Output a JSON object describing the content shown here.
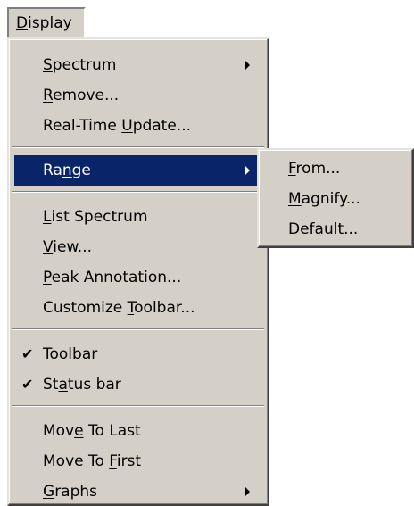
{
  "menubar": {
    "display": {
      "pre": "",
      "u": "D",
      "post": "isplay"
    }
  },
  "menu": {
    "items": [
      {
        "pre": "",
        "u": "S",
        "post": "pectrum"
      },
      {
        "pre": "",
        "u": "R",
        "post": "emove..."
      },
      {
        "pre": "Real-Time ",
        "u": "U",
        "post": "pdate..."
      },
      {
        "pre": "Ra",
        "u": "n",
        "post": "ge"
      },
      {
        "pre": "",
        "u": "L",
        "post": "ist Spectrum"
      },
      {
        "pre": "",
        "u": "V",
        "post": "iew..."
      },
      {
        "pre": "",
        "u": "P",
        "post": "eak Annotation..."
      },
      {
        "pre": "Customize ",
        "u": "T",
        "post": "oolbar..."
      },
      {
        "pre": "T",
        "u": "o",
        "post": "olbar"
      },
      {
        "pre": "St",
        "u": "a",
        "post": "tus bar"
      },
      {
        "pre": "Mov",
        "u": "e",
        "post": " To Last"
      },
      {
        "pre": "Move To ",
        "u": "F",
        "post": "irst"
      },
      {
        "pre": "",
        "u": "G",
        "post": "raphs"
      }
    ]
  },
  "submenu": {
    "items": [
      {
        "pre": "",
        "u": "F",
        "post": "rom..."
      },
      {
        "pre": "",
        "u": "M",
        "post": "agnify..."
      },
      {
        "pre": "",
        "u": "D",
        "post": "efault..."
      }
    ]
  },
  "icons": {
    "check": "✔",
    "submenu_arrow": "chevron-right-icon"
  },
  "colors": {
    "menu_bg": "#d4d0c8",
    "highlight": "#0a246a",
    "highlight_text": "#ffffff"
  }
}
